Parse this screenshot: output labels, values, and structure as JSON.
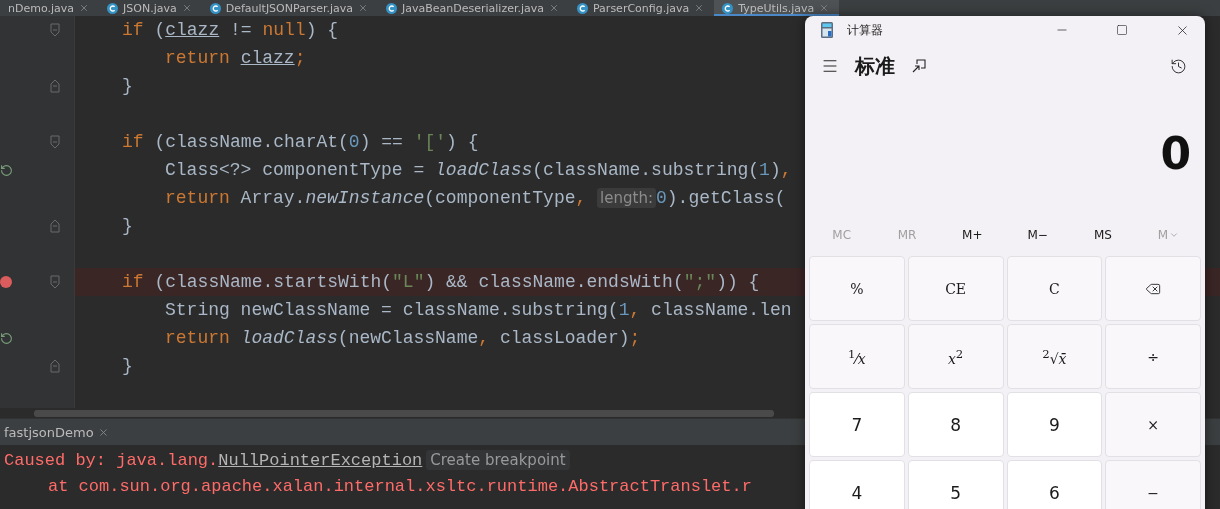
{
  "editor_tabs": [
    {
      "label": "nDemo.java",
      "icon": false,
      "selected": false
    },
    {
      "label": "JSON.java",
      "icon": true,
      "selected": false
    },
    {
      "label": "DefaultJSONParser.java",
      "icon": true,
      "selected": false
    },
    {
      "label": "JavaBeanDeserializer.java",
      "icon": true,
      "selected": false
    },
    {
      "label": "ParserConfig.java",
      "icon": true,
      "selected": false
    },
    {
      "label": "TypeUtils.java",
      "icon": true,
      "selected": true
    }
  ],
  "code_lines": [
    {
      "kind": "code",
      "fold_start": true,
      "fold_end": false,
      "override": false,
      "breakpoint": false,
      "tokens": [
        {
          "kind": "kw",
          "s": "if"
        },
        {
          "kind": "plain",
          "s": " ("
        },
        {
          "kind": "var",
          "s": "clazz"
        },
        {
          "kind": "plain",
          "s": " != "
        },
        {
          "kind": "kw",
          "s": "null"
        },
        {
          "kind": "plain",
          "s": ") {"
        }
      ],
      "children": [
        {
          "kind": "code",
          "fold_start": false,
          "fold_end": false,
          "override": false,
          "breakpoint": false,
          "tokens": [
            {
              "kind": "kw",
              "s": "return "
            },
            {
              "kind": "var",
              "s": "clazz"
            },
            {
              "kind": "kw",
              "s": ";"
            }
          ]
        }
      ]
    },
    {
      "kind": "code",
      "fold_start": false,
      "fold_end": true,
      "override": false,
      "breakpoint": false,
      "tokens": [
        {
          "kind": "plain",
          "s": "}"
        }
      ]
    },
    {
      "kind": "blank",
      "fold_start": false,
      "fold_end": false,
      "override": false,
      "breakpoint": false
    },
    {
      "kind": "code",
      "fold_start": true,
      "fold_end": false,
      "override": false,
      "breakpoint": false,
      "tokens": [
        {
          "kind": "kw",
          "s": "if"
        },
        {
          "kind": "plain",
          "s": " (className.charAt("
        },
        {
          "kind": "num",
          "s": "0"
        },
        {
          "kind": "plain",
          "s": ") == "
        },
        {
          "kind": "str",
          "s": "'['"
        },
        {
          "kind": "plain",
          "s": ") {"
        }
      ],
      "children": [
        {
          "kind": "code",
          "fold_start": false,
          "fold_end": false,
          "override": true,
          "breakpoint": false,
          "tokens": [
            {
              "kind": "plain",
              "s": "Class<?> componentType = "
            },
            {
              "kind": "method",
              "s": "loadClass"
            },
            {
              "kind": "plain",
              "s": "(className.substring("
            },
            {
              "kind": "num",
              "s": "1"
            },
            {
              "kind": "plain",
              "s": ")"
            },
            {
              "kind": "kw",
              "s": ","
            }
          ]
        },
        {
          "kind": "code",
          "fold_start": false,
          "fold_end": false,
          "override": false,
          "breakpoint": false,
          "tokens": [
            {
              "kind": "kw",
              "s": "return"
            },
            {
              "kind": "plain",
              "s": " Array."
            },
            {
              "kind": "method",
              "s": "newInstance"
            },
            {
              "kind": "plain",
              "s": "(componentType"
            },
            {
              "kind": "kw",
              "s": ", "
            },
            {
              "kind": "hint",
              "s": "length:"
            },
            {
              "kind": "num",
              "s": "0"
            },
            {
              "kind": "plain",
              "s": ").getClass("
            }
          ]
        }
      ]
    },
    {
      "kind": "code",
      "fold_start": false,
      "fold_end": true,
      "override": false,
      "breakpoint": false,
      "tokens": [
        {
          "kind": "plain",
          "s": "}"
        }
      ]
    },
    {
      "kind": "blank",
      "fold_start": false,
      "fold_end": false,
      "override": false,
      "breakpoint": false
    },
    {
      "kind": "code",
      "fold_start": true,
      "fold_end": false,
      "override": false,
      "breakpoint": true,
      "tokens": [
        {
          "kind": "kw",
          "s": "if"
        },
        {
          "kind": "plain",
          "s": " (className.startsWith("
        },
        {
          "kind": "str",
          "s": "\"L\""
        },
        {
          "kind": "plain",
          "s": ") && className.endsWith("
        },
        {
          "kind": "str",
          "s": "\";\""
        },
        {
          "kind": "plain",
          "s": ")) {"
        }
      ],
      "children": [
        {
          "kind": "code",
          "fold_start": false,
          "fold_end": false,
          "override": false,
          "breakpoint": false,
          "tokens": [
            {
              "kind": "plain",
              "s": "String newClassName = className.substring("
            },
            {
              "kind": "num",
              "s": "1"
            },
            {
              "kind": "kw",
              "s": ","
            },
            {
              "kind": "plain",
              "s": " className.len"
            }
          ]
        },
        {
          "kind": "code",
          "fold_start": false,
          "fold_end": false,
          "override": true,
          "breakpoint": false,
          "tokens": [
            {
              "kind": "kw",
              "s": "return "
            },
            {
              "kind": "method",
              "s": "loadClass"
            },
            {
              "kind": "plain",
              "s": "(newClassName"
            },
            {
              "kind": "kw",
              "s": ","
            },
            {
              "kind": "plain",
              "s": " classLoader)"
            },
            {
              "kind": "kw",
              "s": ";"
            }
          ]
        }
      ]
    },
    {
      "kind": "code",
      "fold_start": false,
      "fold_end": true,
      "override": false,
      "breakpoint": false,
      "tokens": [
        {
          "kind": "plain",
          "s": "}"
        }
      ]
    },
    {
      "kind": "blank",
      "fold_start": false,
      "fold_end": false,
      "override": false,
      "breakpoint": false
    }
  ],
  "run_panel": {
    "tab": "fastjsonDemo",
    "lines": [
      {
        "kind": "exception",
        "prefix": "Caused by: java.lang.",
        "link": "NullPointerException",
        "hint": "Create breakpoint"
      },
      {
        "kind": "trace",
        "text": "at com.sun.org.apache.xalan.internal.xsltc.runtime.AbstractTranslet.r"
      }
    ]
  },
  "calculator": {
    "title": "计算器",
    "mode": "标准",
    "display": "0",
    "memory": [
      {
        "label": "MC",
        "kind": "plain",
        "disabled": true
      },
      {
        "label": "MR",
        "kind": "plain",
        "disabled": true
      },
      {
        "label": "M+",
        "kind": "plain",
        "disabled": false
      },
      {
        "label": "M−",
        "kind": "plain",
        "disabled": false
      },
      {
        "label": "MS",
        "kind": "plain",
        "disabled": false
      },
      {
        "label": "M",
        "kind": "dropdown",
        "disabled": true
      }
    ],
    "keys": [
      {
        "label": "%",
        "kind": "function"
      },
      {
        "label": "CE",
        "kind": "function"
      },
      {
        "label": "C",
        "kind": "function"
      },
      {
        "kind": "backspace"
      },
      {
        "label": "$^{1}$⁄*x*",
        "kind": "function"
      },
      {
        "label": "*x*$^{2}$",
        "kind": "function"
      },
      {
        "label": "$^{2}$√*x̄*",
        "kind": "function"
      },
      {
        "label": "÷",
        "kind": "function"
      },
      {
        "label": "7",
        "kind": "digit"
      },
      {
        "label": "8",
        "kind": "digit"
      },
      {
        "label": "9",
        "kind": "digit"
      },
      {
        "label": "×",
        "kind": "function"
      },
      {
        "label": "4",
        "kind": "digit"
      },
      {
        "label": "5",
        "kind": "digit"
      },
      {
        "label": "6",
        "kind": "digit"
      },
      {
        "label": "−",
        "kind": "function"
      }
    ]
  }
}
